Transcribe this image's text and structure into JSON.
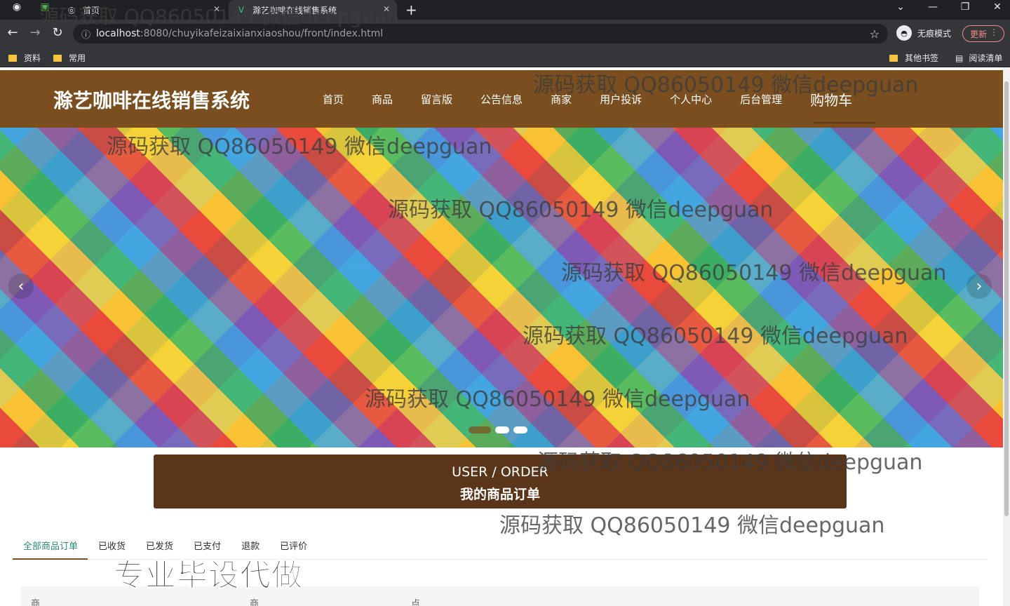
{
  "browser": {
    "tabs": [
      {
        "title": "首页",
        "active": false
      },
      {
        "title": "滁艺咖啡在线销售系统",
        "active": true
      }
    ],
    "new_tab": "+",
    "url_host": "localhost",
    "url_path": ":8080/chuyikafeizaixianxiaoshou/front/index.html",
    "incognito_label": "无痕模式",
    "update_label": "更新",
    "bookmarks": [
      "资料",
      "常用"
    ],
    "bookmarks_right": [
      "其他书签",
      "阅读清单"
    ]
  },
  "site": {
    "brand": "滁艺咖啡在线销售系统",
    "menu": [
      "首页",
      "商品",
      "留言版",
      "公告信息",
      "商家",
      "用户投诉",
      "个人中心",
      "后台管理",
      "购物车"
    ],
    "banner": {
      "prev": "‹",
      "next": "›",
      "dots": 3,
      "active_dot": 0
    }
  },
  "order_section": {
    "title_en": "USER / ORDER",
    "title_cn": "我的商品订单",
    "tabs": [
      "全部商品订单",
      "已收货",
      "已发货",
      "已支付",
      "退款",
      "已评价"
    ],
    "active_tab": 0,
    "table_headers": [
      "商",
      "商",
      "点"
    ]
  },
  "overlays": {
    "watermark": "源码获取 QQ86050149 微信deepguan",
    "promo": "专业毕设代做"
  },
  "colors": {
    "header_bg": "#7a4e1f",
    "order_banner_bg": "#5a3519",
    "active_tab_text": "#2e8b7a"
  }
}
